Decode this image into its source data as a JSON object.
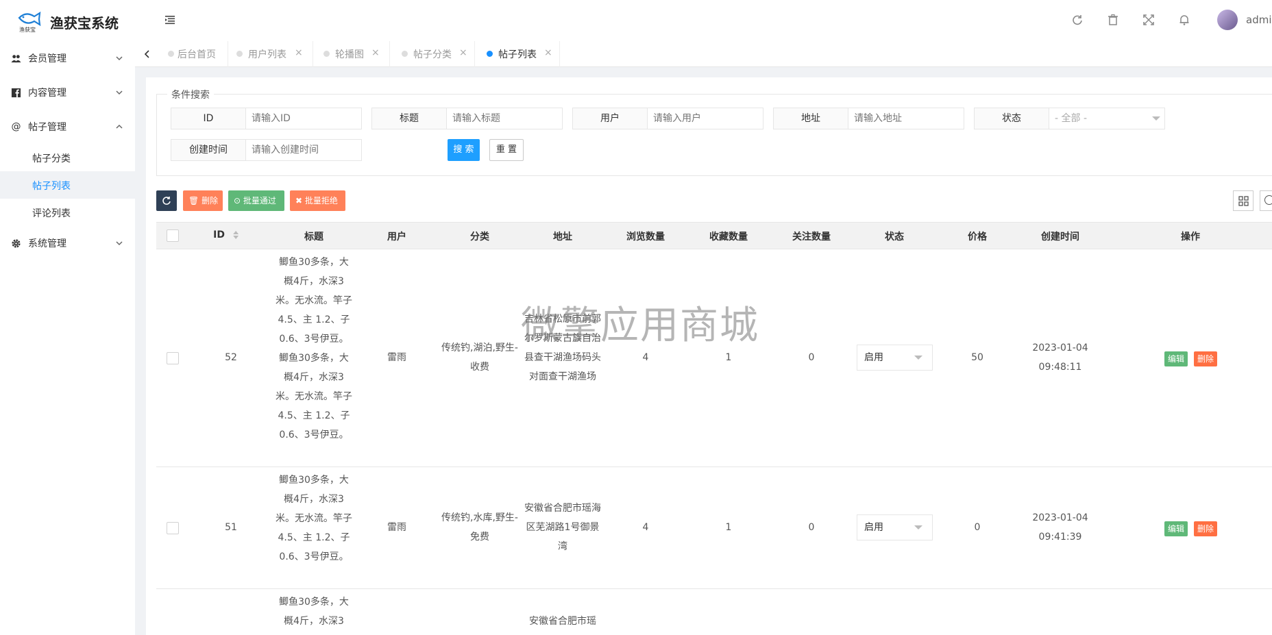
{
  "app": {
    "title": "渔获宝系统",
    "logo_text": "渔获宝",
    "user": "admin"
  },
  "sidebar": {
    "items": [
      {
        "label": "会员管理",
        "icon": "users-icon"
      },
      {
        "label": "内容管理",
        "icon": "facebook-square-icon"
      },
      {
        "label": "帖子管理",
        "icon": "at-icon"
      },
      {
        "label": "系统管理",
        "icon": "gear-icon"
      }
    ],
    "sub_items": [
      {
        "label": "帖子分类"
      },
      {
        "label": "帖子列表",
        "active": true
      },
      {
        "label": "评论列表"
      }
    ]
  },
  "tabs": [
    {
      "label": "后台首页"
    },
    {
      "label": "用户列表"
    },
    {
      "label": "轮播图"
    },
    {
      "label": "帖子分类"
    },
    {
      "label": "帖子列表",
      "active": true
    }
  ],
  "search": {
    "legend": "条件搜索",
    "fields": [
      {
        "label": "ID",
        "placeholder": "请输入ID"
      },
      {
        "label": "标题",
        "placeholder": "请输入标题"
      },
      {
        "label": "用户",
        "placeholder": "请输入用户"
      },
      {
        "label": "地址",
        "placeholder": "请输入地址"
      },
      {
        "label": "状态",
        "placeholder": "- 全部 -"
      },
      {
        "label": "创建时间",
        "placeholder": "请输入创建时间"
      }
    ],
    "search_label": "搜 索",
    "reset_label": "重 置"
  },
  "toolbar": {
    "delete_label": "删除",
    "pass_label": "批量通过",
    "reject_label": "批量拒绝"
  },
  "table": {
    "columns": [
      "ID",
      "标题",
      "用户",
      "分类",
      "地址",
      "浏览数量",
      "收藏数量",
      "关注数量",
      "状态",
      "价格",
      "创建时间",
      "操作"
    ],
    "rows": [
      {
        "id": "52",
        "title": "鲫鱼30多条，大概4斤，水深3米。无水流。竿子4.5、主 1.2、子0.6、3号伊豆。鲫鱼30多条，大概4斤，水深3米。无水流。竿子4.5、主 1.2、子0.6、3号伊豆。",
        "user": "雷雨",
        "category": "传统钓,湖泊,野生-收费",
        "address": "吉林省松原市前郭尔罗斯蒙古族自治县查干湖渔场码头对面查干湖渔场",
        "views": "4",
        "favorites": "1",
        "follows": "0",
        "status": "启用",
        "price": "50",
        "created": "2023-01-04 09:48:11",
        "edit": "编辑",
        "delete": "删除"
      },
      {
        "id": "51",
        "title": "鲫鱼30多条，大概4斤，水深3米。无水流。竿子4.5、主 1.2、子0.6、3号伊豆。",
        "user": "雷雨",
        "category": "传统钓,水库,野生-免费",
        "address": "安徽省合肥市瑶海区芜湖路1号御景湾",
        "views": "4",
        "favorites": "1",
        "follows": "0",
        "status": "启用",
        "price": "0",
        "created": "2023-01-04 09:41:39",
        "edit": "编辑",
        "delete": "删除"
      },
      {
        "title": "鲫鱼30多条，大概4斤，水深3",
        "address": "安徽省合肥市瑶"
      }
    ]
  },
  "watermark": "微擎应用商城",
  "colors": {
    "primary": "#1890ff",
    "success": "#5fb878",
    "danger": "#ff5722",
    "dark": "#2f4056"
  }
}
